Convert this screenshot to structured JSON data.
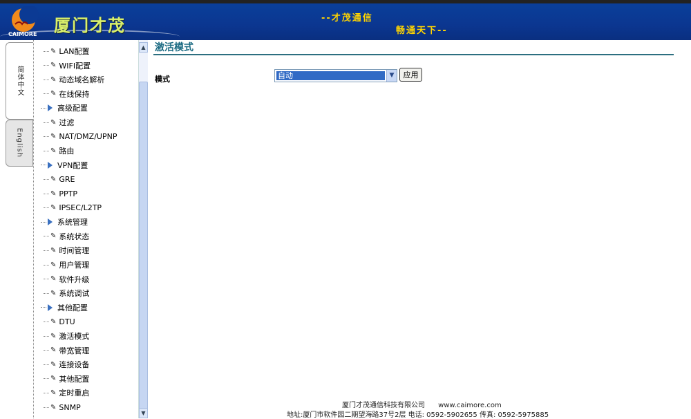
{
  "header": {
    "brand": "厦门才茂",
    "logo_text": "CAIMORE",
    "slogan1": "--才茂通信",
    "slogan2": "畅通天下--"
  },
  "lang_tabs": [
    {
      "label": "简体中文"
    },
    {
      "label": "English"
    }
  ],
  "menu": [
    {
      "type": "leaf",
      "label": "LAN配置"
    },
    {
      "type": "leaf",
      "label": "WIFI配置"
    },
    {
      "type": "leaf",
      "label": "动态域名解析"
    },
    {
      "type": "leaf",
      "label": "在线保持"
    },
    {
      "type": "group",
      "label": "高级配置"
    },
    {
      "type": "leaf",
      "label": "过滤"
    },
    {
      "type": "leaf",
      "label": "NAT/DMZ/UPNP"
    },
    {
      "type": "leaf",
      "label": "路由"
    },
    {
      "type": "group",
      "label": "VPN配置"
    },
    {
      "type": "leaf",
      "label": "GRE"
    },
    {
      "type": "leaf",
      "label": "PPTP"
    },
    {
      "type": "leaf",
      "label": "IPSEC/L2TP"
    },
    {
      "type": "group",
      "label": "系统管理"
    },
    {
      "type": "leaf",
      "label": "系统状态"
    },
    {
      "type": "leaf",
      "label": "时间管理"
    },
    {
      "type": "leaf",
      "label": "用户管理"
    },
    {
      "type": "leaf",
      "label": "软件升级"
    },
    {
      "type": "leaf",
      "label": "系统调试"
    },
    {
      "type": "group",
      "label": "其他配置"
    },
    {
      "type": "leaf",
      "label": "DTU"
    },
    {
      "type": "leaf",
      "label": "激活模式"
    },
    {
      "type": "leaf",
      "label": "带宽管理"
    },
    {
      "type": "leaf",
      "label": "连接设备"
    },
    {
      "type": "leaf",
      "label": "其他配置"
    },
    {
      "type": "leaf",
      "label": "定时重启"
    },
    {
      "type": "leaf",
      "label": "SNMP"
    }
  ],
  "main": {
    "title": "激活模式",
    "mode_label": "模式",
    "mode_value": "自动",
    "apply_label": "应用"
  },
  "footer": {
    "company": "厦门才茂通信科技有限公司      www.caimore.com",
    "address": "地址:厦门市软件园二期望海路37号2层  电话: 0592-5902655 传真: 0592-5975885"
  }
}
